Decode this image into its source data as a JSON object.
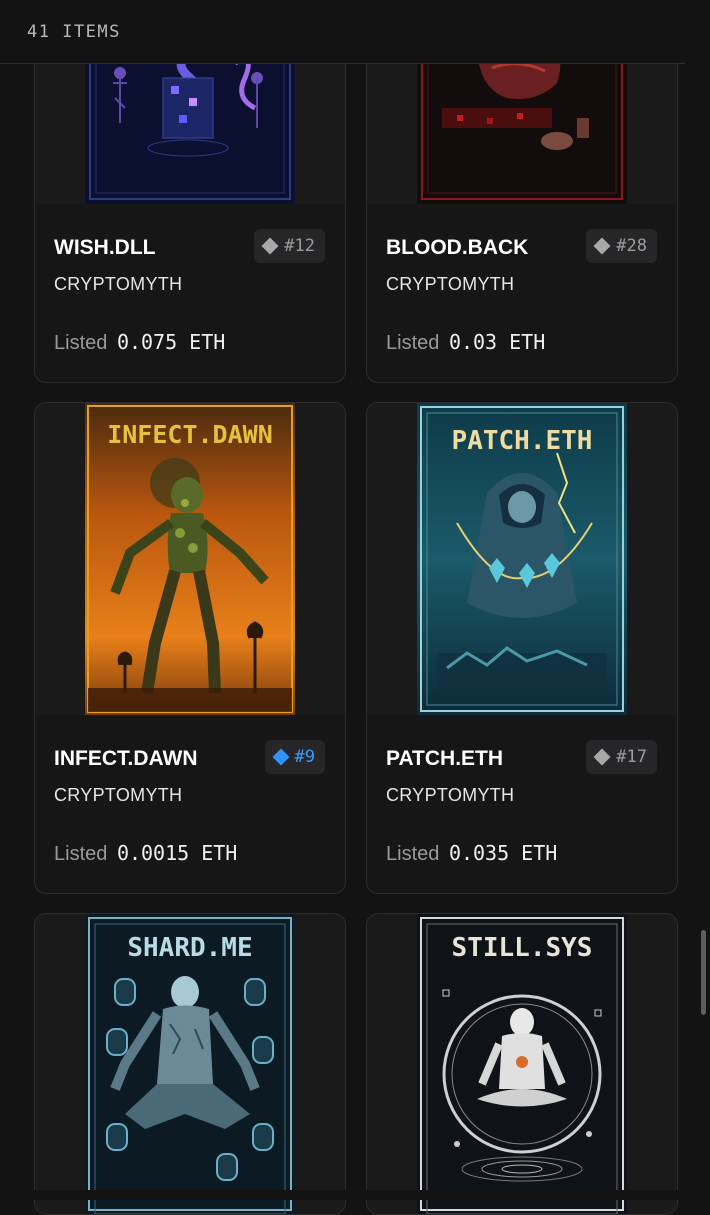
{
  "header": {
    "item_count": "41 ITEMS"
  },
  "cards": [
    {
      "title": "WISH.DLL",
      "collection": "CRYPTOMYTH",
      "listed_label": "Listed",
      "price": "0.075 ETH",
      "rank": "#12",
      "rank_highlight": false,
      "art_title": ""
    },
    {
      "title": "BLOOD.BACK",
      "collection": "CRYPTOMYTH",
      "listed_label": "Listed",
      "price": "0.03 ETH",
      "rank": "#28",
      "rank_highlight": false,
      "art_title": ""
    },
    {
      "title": "INFECT.DAWN",
      "collection": "CRYPTOMYTH",
      "listed_label": "Listed",
      "price": "0.0015 ETH",
      "rank": "#9",
      "rank_highlight": true,
      "art_title": "INFECT.DAWN"
    },
    {
      "title": "PATCH.ETH",
      "collection": "CRYPTOMYTH",
      "listed_label": "Listed",
      "price": "0.035 ETH",
      "rank": "#17",
      "rank_highlight": false,
      "art_title": "PATCH.ETH"
    },
    {
      "art_title": "SHARD.ME"
    },
    {
      "art_title": "STILL.SYS"
    }
  ],
  "colors": {
    "rank_highlight": "#2e93ff",
    "background": "#131313"
  }
}
